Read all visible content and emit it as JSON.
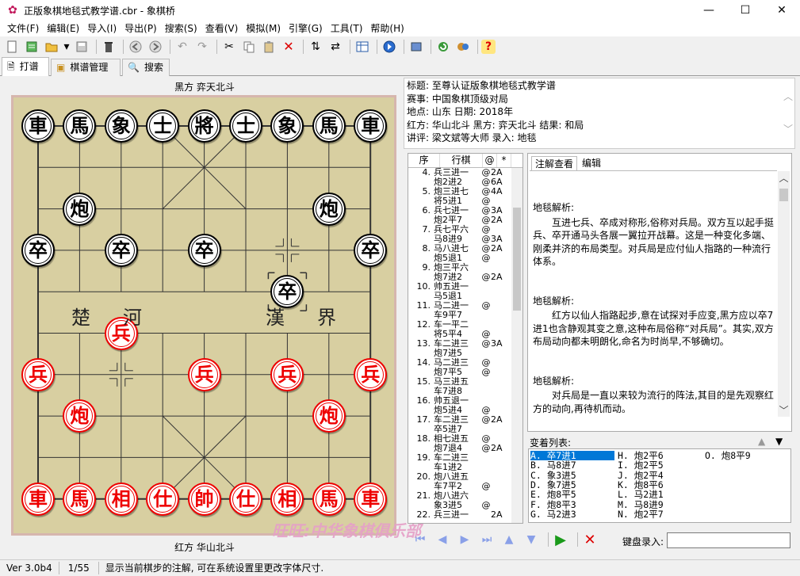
{
  "window": {
    "title": "正版象棋地毯式教学谱.cbr - 象棋桥",
    "minimize": "—",
    "maximize": "☐",
    "close": "✕"
  },
  "menu": [
    "文件(F)",
    "编辑(E)",
    "导入(I)",
    "导出(P)",
    "搜索(S)",
    "查看(V)",
    "模拟(M)",
    "引擎(G)",
    "工具(T)",
    "帮助(H)"
  ],
  "toolbar_icons": [
    "new-icon",
    "notes-icon",
    "open-icon",
    "dropdown-icon",
    "save-icon",
    "delete-icon",
    "back-icon",
    "forward-icon",
    "undo-icon",
    "redo-icon",
    "cut-icon",
    "copy-icon",
    "paste-icon",
    "remove-icon",
    "flip-vertical-icon",
    "flip-horizontal-icon",
    "board-icon",
    "play-icon",
    "book-icon",
    "refresh-icon",
    "engine-icon",
    "help-icon"
  ],
  "tabs": [
    {
      "label": "打谱",
      "icon": "document-icon"
    },
    {
      "label": "棋谱管理",
      "icon": "folder-icon"
    },
    {
      "label": "搜索",
      "icon": "search-icon"
    }
  ],
  "board": {
    "top_label": "黑方  弈天北斗",
    "bottom_label": "红方  华山北斗",
    "river": [
      "楚",
      "河",
      "漢",
      "界"
    ],
    "watermark": "旺旺:中华象棋俱乐部",
    "pieces": [
      {
        "t": "車",
        "c": "black",
        "col": 0,
        "row": 0
      },
      {
        "t": "馬",
        "c": "black",
        "col": 1,
        "row": 0
      },
      {
        "t": "象",
        "c": "black",
        "col": 2,
        "row": 0
      },
      {
        "t": "士",
        "c": "black",
        "col": 3,
        "row": 0
      },
      {
        "t": "將",
        "c": "black",
        "col": 4,
        "row": 0
      },
      {
        "t": "士",
        "c": "black",
        "col": 5,
        "row": 0
      },
      {
        "t": "象",
        "c": "black",
        "col": 6,
        "row": 0
      },
      {
        "t": "馬",
        "c": "black",
        "col": 7,
        "row": 0
      },
      {
        "t": "車",
        "c": "black",
        "col": 8,
        "row": 0
      },
      {
        "t": "炮",
        "c": "black",
        "col": 1,
        "row": 2
      },
      {
        "t": "炮",
        "c": "black",
        "col": 7,
        "row": 2
      },
      {
        "t": "卒",
        "c": "black",
        "col": 0,
        "row": 3
      },
      {
        "t": "卒",
        "c": "black",
        "col": 2,
        "row": 3
      },
      {
        "t": "卒",
        "c": "black",
        "col": 4,
        "row": 3
      },
      {
        "t": "卒",
        "c": "black",
        "col": 6,
        "row": 4
      },
      {
        "t": "卒",
        "c": "black",
        "col": 8,
        "row": 3
      },
      {
        "t": "兵",
        "c": "red",
        "col": 2,
        "row": 5
      },
      {
        "t": "兵",
        "c": "red",
        "col": 0,
        "row": 6
      },
      {
        "t": "兵",
        "c": "red",
        "col": 4,
        "row": 6
      },
      {
        "t": "兵",
        "c": "red",
        "col": 6,
        "row": 6
      },
      {
        "t": "兵",
        "c": "red",
        "col": 8,
        "row": 6
      },
      {
        "t": "炮",
        "c": "red",
        "col": 1,
        "row": 7
      },
      {
        "t": "炮",
        "c": "red",
        "col": 7,
        "row": 7
      },
      {
        "t": "車",
        "c": "red",
        "col": 0,
        "row": 9
      },
      {
        "t": "馬",
        "c": "red",
        "col": 1,
        "row": 9
      },
      {
        "t": "相",
        "c": "red",
        "col": 2,
        "row": 9
      },
      {
        "t": "仕",
        "c": "red",
        "col": 3,
        "row": 9
      },
      {
        "t": "帥",
        "c": "red",
        "col": 4,
        "row": 9
      },
      {
        "t": "仕",
        "c": "red",
        "col": 5,
        "row": 9
      },
      {
        "t": "相",
        "c": "red",
        "col": 6,
        "row": 9
      },
      {
        "t": "馬",
        "c": "red",
        "col": 7,
        "row": 9
      },
      {
        "t": "車",
        "c": "red",
        "col": 8,
        "row": 9
      }
    ]
  },
  "info": [
    "标题: 至尊认证版象棋地毯式教学谱",
    "赛事: 中国象棋顶级对局",
    "地点: 山东    日期: 2018年",
    "红方: 华山北斗     黑方: 弈天北斗     结果: 和局",
    "讲评: 梁文斌等大师    录入: 地毯"
  ],
  "movelist": {
    "headers": [
      "序",
      "行棋",
      "@",
      "*"
    ],
    "rows": [
      {
        "n": "4.",
        "m": "兵三进一",
        "mk": "@",
        "c": "2A"
      },
      {
        "n": "",
        "m": "炮2进2",
        "mk": "@",
        "c": "6A"
      },
      {
        "n": "5.",
        "m": "炮三进七",
        "mk": "@",
        "c": "4A"
      },
      {
        "n": "",
        "m": "将5进1",
        "mk": "@",
        "c": ""
      },
      {
        "n": "6.",
        "m": "兵七进一",
        "mk": "@",
        "c": "3A"
      },
      {
        "n": "",
        "m": "炮2平7",
        "mk": "@",
        "c": "2A"
      },
      {
        "n": "7.",
        "m": "兵七平六",
        "mk": "@",
        "c": ""
      },
      {
        "n": "",
        "m": "马8进9",
        "mk": "@",
        "c": "3A"
      },
      {
        "n": "8.",
        "m": "马八进七",
        "mk": "@",
        "c": "2A"
      },
      {
        "n": "",
        "m": "炮5退1",
        "mk": "@",
        "c": ""
      },
      {
        "n": "9.",
        "m": "炮三平六",
        "mk": "",
        "c": ""
      },
      {
        "n": "",
        "m": "炮7进2",
        "mk": "@",
        "c": "2A"
      },
      {
        "n": "10.",
        "m": "帅五进一",
        "mk": "",
        "c": ""
      },
      {
        "n": "",
        "m": "马5退1",
        "mk": "",
        "c": ""
      },
      {
        "n": "11.",
        "m": "马二进一",
        "mk": "@",
        "c": ""
      },
      {
        "n": "",
        "m": "车9平7",
        "mk": "",
        "c": ""
      },
      {
        "n": "12.",
        "m": "车一平二",
        "mk": "",
        "c": ""
      },
      {
        "n": "",
        "m": "将5平4",
        "mk": "@",
        "c": ""
      },
      {
        "n": "13.",
        "m": "车二进三",
        "mk": "@",
        "c": "3A"
      },
      {
        "n": "",
        "m": "炮7进5",
        "mk": "",
        "c": ""
      },
      {
        "n": "14.",
        "m": "马二进三",
        "mk": "@",
        "c": ""
      },
      {
        "n": "",
        "m": "炮7平5",
        "mk": "@",
        "c": ""
      },
      {
        "n": "15.",
        "m": "马三进五",
        "mk": "",
        "c": ""
      },
      {
        "n": "",
        "m": "车7进8",
        "mk": "",
        "c": ""
      },
      {
        "n": "16.",
        "m": "帅五退一",
        "mk": "",
        "c": ""
      },
      {
        "n": "",
        "m": "炮5进4",
        "mk": "@",
        "c": ""
      },
      {
        "n": "17.",
        "m": "车二进三",
        "mk": "@",
        "c": "2A"
      },
      {
        "n": "",
        "m": "卒5进7",
        "mk": "",
        "c": ""
      },
      {
        "n": "18.",
        "m": "相七进五",
        "mk": "@",
        "c": ""
      },
      {
        "n": "",
        "m": "炮7退4",
        "mk": "@",
        "c": "2A"
      },
      {
        "n": "19.",
        "m": "车二进三",
        "mk": "",
        "c": ""
      },
      {
        "n": "",
        "m": "车1进2",
        "mk": "",
        "c": ""
      },
      {
        "n": "20.",
        "m": "炮八进五",
        "mk": "",
        "c": ""
      },
      {
        "n": "",
        "m": "车7平2",
        "mk": "@",
        "c": ""
      },
      {
        "n": "21.",
        "m": "炮八进六",
        "mk": "",
        "c": ""
      },
      {
        "n": "",
        "m": "象3进5",
        "mk": "@",
        "c": ""
      },
      {
        "n": "22.",
        "m": "兵三进一",
        "mk": "",
        "c": "2A"
      }
    ]
  },
  "notes": {
    "tabs": [
      "注解查看",
      "编辑"
    ],
    "paragraphs": [
      {
        "title": "地毯解析:",
        "body": "互进七兵、卒成对称形,俗称对兵局。双方互以起手挺兵、卒开通马头各展一翼拉开战幕。这是一种变化多端、刚柔并济的布局类型。对兵局是应付仙人指路的一种流行体系。"
      },
      {
        "title": "地毯解析:",
        "body": "红方以仙人指路起步,意在试探对手应变,黑方应以卒7进1也含静观其变之意,这种布局俗称“对兵局”。其实,双方布局动向都未明朗化,命名为时尚早,不够确切。"
      },
      {
        "title": "地毯解析:",
        "body": "对兵局是一直以来较为流行的阵法,其目的是先观察红方的动向,再待机而动。"
      }
    ]
  },
  "variations": {
    "label": "变着列表:",
    "items": [
      {
        "k": "A.",
        "v": "卒7进1",
        "sel": true
      },
      {
        "k": "B.",
        "v": "马8进7"
      },
      {
        "k": "C.",
        "v": "象3进5"
      },
      {
        "k": "D.",
        "v": "象7进5"
      },
      {
        "k": "E.",
        "v": "炮8平5"
      },
      {
        "k": "F.",
        "v": "炮8平3"
      },
      {
        "k": "G.",
        "v": "马2进3"
      },
      {
        "k": "H.",
        "v": "炮2平6"
      },
      {
        "k": "I.",
        "v": "炮2平5"
      },
      {
        "k": "J.",
        "v": "炮2平4"
      },
      {
        "k": "K.",
        "v": "炮8平6"
      },
      {
        "k": "L.",
        "v": "马2进1"
      },
      {
        "k": "M.",
        "v": "马8进9"
      },
      {
        "k": "N.",
        "v": "炮2平7"
      },
      {
        "k": "O.",
        "v": "炮8平9"
      }
    ]
  },
  "keyboard_label": "键盘录入:",
  "status": {
    "version": "Ver 3.0b4",
    "move": "1/55",
    "message": "显示当前棋步的注解, 可在系统设置里更改字体尺寸."
  }
}
